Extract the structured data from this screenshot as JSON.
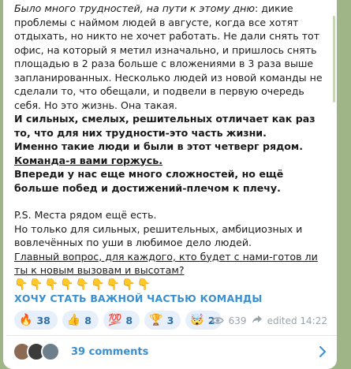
{
  "post": {
    "paragraphs": [
      {
        "italic_lead": "Было много трудностей, на пути к этому дню",
        "rest": ": дикие проблемы с наймом людей в августе, когда все хотят отдыхать, но никто не хочет работать. Не дали снять тот офис, на который я метил изначально, и пришлось снять площадью в 2 раза больше с вложениями в 3 раза выше запланированных. Несколько  людей из новой команды не сделали то, что обещали, и подвели в первую очередь себя. Но это жизнь. Она такая."
      },
      {
        "bold": "И сильных, смелых, решительных отличает как раз то, что для них трудности-это часть жизни."
      },
      {
        "bold": "Именно такие люди и были в этот четверг рядом."
      },
      {
        "bold_underline": "Команда-я вами горжусь."
      },
      {
        "bold": "Впереди у нас еще много сложностей, но ещё больше побед и достижений-плечом к плечу."
      }
    ],
    "ps_lines": [
      "P.S. Места рядом ещё есть.",
      "Но только для сильных, решительных, амбициозных и вовлечённых по уши в любимое дело людей."
    ],
    "question": "Главный вопрос, для каждого, кто будет с нами-готов ли ты к новым вызовам и высотам?",
    "pointing_emojis": "👇👇👇👇👇👇👇👇👇",
    "cta_link": "ХОЧУ СТАТЬ ВАЖНОЙ ЧАСТЬЮ КОМАНДЫ"
  },
  "reactions": [
    {
      "emoji": "🔥",
      "count": "38"
    },
    {
      "emoji": "👍",
      "count": "8"
    },
    {
      "emoji": "💯",
      "count": "8"
    },
    {
      "emoji": "🏆",
      "count": "3"
    },
    {
      "emoji": "🤯",
      "count": "2"
    }
  ],
  "meta": {
    "views": "639",
    "edited": "edited 14:22"
  },
  "comments": {
    "label": "39 comments",
    "avatar_colors": [
      "#8a6a52",
      "#3b3b3b",
      "#6e7f8c"
    ]
  },
  "colors": {
    "accent": "#3a8fcf",
    "background": "#9fb587",
    "reaction_bg": "#e7f0fa"
  }
}
